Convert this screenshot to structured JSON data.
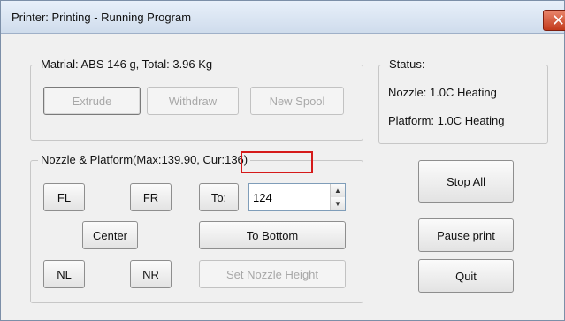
{
  "window": {
    "title": "Printer: Printing - Running Program",
    "close_glyph": "✕"
  },
  "material": {
    "legend": "Matrial: ABS 146 g,  Total: 3.96 Kg",
    "buttons": {
      "extrude": "Extrude",
      "withdraw": "Withdraw",
      "new_spool": "New Spool"
    }
  },
  "status": {
    "legend": "Status:",
    "nozzle": "Nozzle: 1.0C Heating",
    "platform": "Platform: 1.0C Heating"
  },
  "nozzle_platform": {
    "legend_prefix": "Nozzle & Platform(Max:139.90, ",
    "legend_cur": "Cur:136)",
    "buttons": {
      "fl": "FL",
      "fr": "FR",
      "center": "Center",
      "nl": "NL",
      "nr": "NR",
      "to": "To:",
      "to_bottom": "To Bottom",
      "set_nozzle_height": "Set Nozzle Height"
    },
    "height_value": "124"
  },
  "actions": {
    "stop_all": "Stop All",
    "pause_print": "Pause print",
    "quit": "Quit"
  },
  "icons": {
    "spin_up": "▲",
    "spin_down": "▼"
  },
  "colors": {
    "highlight": "#d51a1a",
    "close_button": "#c2391b"
  }
}
